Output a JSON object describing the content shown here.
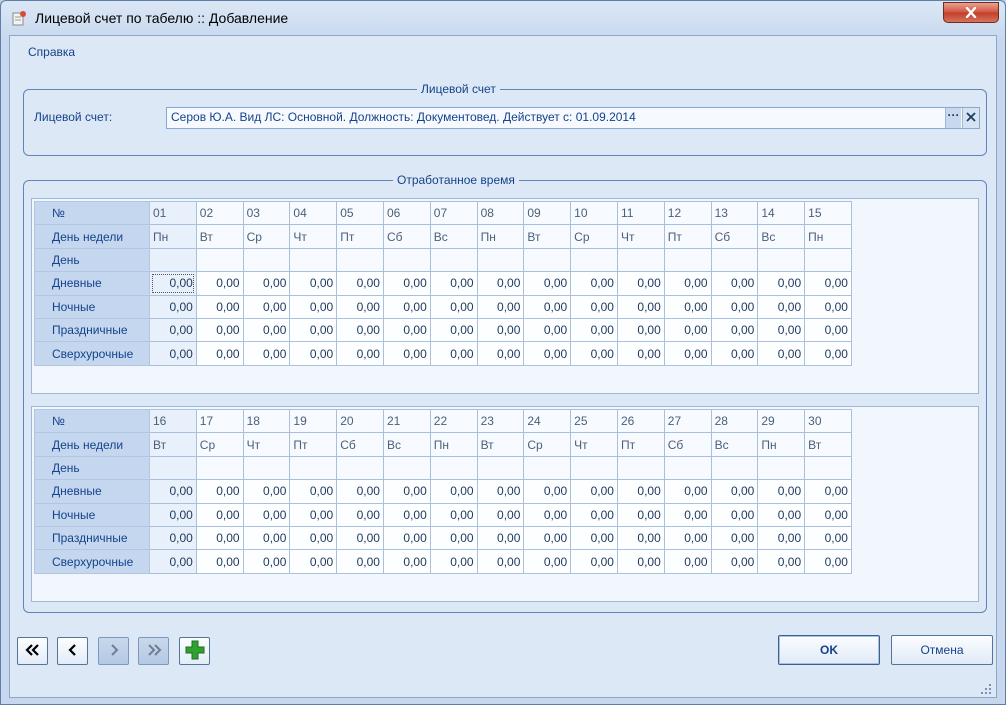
{
  "window": {
    "title": "Лицевой счет по табелю :: Добавление"
  },
  "menu": {
    "help": "Справка"
  },
  "account_group": {
    "legend": "Лицевой счет",
    "label": "Лицевой счет:",
    "value": "Серов Ю.А. Вид ЛС: Основной. Должность: Документовед. Действует с: 01.09.2014",
    "browse_label": "···"
  },
  "time_group": {
    "legend": "Отработанное время"
  },
  "row_labels": {
    "num": "№",
    "weekday": "День недели",
    "day": "День",
    "daytime": "Дневные",
    "night": "Ночные",
    "holiday": "Праздничные",
    "overtime": "Сверхурочные"
  },
  "grid1": {
    "days": [
      "01",
      "02",
      "03",
      "04",
      "05",
      "06",
      "07",
      "08",
      "09",
      "10",
      "11",
      "12",
      "13",
      "14",
      "15"
    ],
    "weekdays": [
      "Пн",
      "Вт",
      "Ср",
      "Чт",
      "Пт",
      "Сб",
      "Вс",
      "Пн",
      "Вт",
      "Ср",
      "Чт",
      "Пт",
      "Сб",
      "Вс",
      "Пн"
    ],
    "daytime": [
      "0,00",
      "0,00",
      "0,00",
      "0,00",
      "0,00",
      "0,00",
      "0,00",
      "0,00",
      "0,00",
      "0,00",
      "0,00",
      "0,00",
      "0,00",
      "0,00",
      "0,00"
    ],
    "night": [
      "0,00",
      "0,00",
      "0,00",
      "0,00",
      "0,00",
      "0,00",
      "0,00",
      "0,00",
      "0,00",
      "0,00",
      "0,00",
      "0,00",
      "0,00",
      "0,00",
      "0,00"
    ],
    "holiday": [
      "0,00",
      "0,00",
      "0,00",
      "0,00",
      "0,00",
      "0,00",
      "0,00",
      "0,00",
      "0,00",
      "0,00",
      "0,00",
      "0,00",
      "0,00",
      "0,00",
      "0,00"
    ],
    "overtime": [
      "0,00",
      "0,00",
      "0,00",
      "0,00",
      "0,00",
      "0,00",
      "0,00",
      "0,00",
      "0,00",
      "0,00",
      "0,00",
      "0,00",
      "0,00",
      "0,00",
      "0,00"
    ]
  },
  "grid2": {
    "days": [
      "16",
      "17",
      "18",
      "19",
      "20",
      "21",
      "22",
      "23",
      "24",
      "25",
      "26",
      "27",
      "28",
      "29",
      "30"
    ],
    "weekdays": [
      "Вт",
      "Ср",
      "Чт",
      "Пт",
      "Сб",
      "Вс",
      "Пн",
      "Вт",
      "Ср",
      "Чт",
      "Пт",
      "Сб",
      "Вс",
      "Пн",
      "Вт"
    ],
    "daytime": [
      "0,00",
      "0,00",
      "0,00",
      "0,00",
      "0,00",
      "0,00",
      "0,00",
      "0,00",
      "0,00",
      "0,00",
      "0,00",
      "0,00",
      "0,00",
      "0,00",
      "0,00"
    ],
    "night": [
      "0,00",
      "0,00",
      "0,00",
      "0,00",
      "0,00",
      "0,00",
      "0,00",
      "0,00",
      "0,00",
      "0,00",
      "0,00",
      "0,00",
      "0,00",
      "0,00",
      "0,00"
    ],
    "holiday": [
      "0,00",
      "0,00",
      "0,00",
      "0,00",
      "0,00",
      "0,00",
      "0,00",
      "0,00",
      "0,00",
      "0,00",
      "0,00",
      "0,00",
      "0,00",
      "0,00",
      "0,00"
    ],
    "overtime": [
      "0,00",
      "0,00",
      "0,00",
      "0,00",
      "0,00",
      "0,00",
      "0,00",
      "0,00",
      "0,00",
      "0,00",
      "0,00",
      "0,00",
      "0,00",
      "0,00",
      "0,00"
    ]
  },
  "buttons": {
    "ok": "OK",
    "cancel": "Отмена"
  },
  "icons": {
    "first": "double-chevron-left-icon",
    "prev": "chevron-left-icon",
    "next": "chevron-right-icon",
    "last": "double-chevron-right-icon",
    "add": "plus-icon",
    "close": "close-icon"
  },
  "colors": {
    "add_icon": "#2fa12f",
    "close_button": "#c94a33"
  }
}
